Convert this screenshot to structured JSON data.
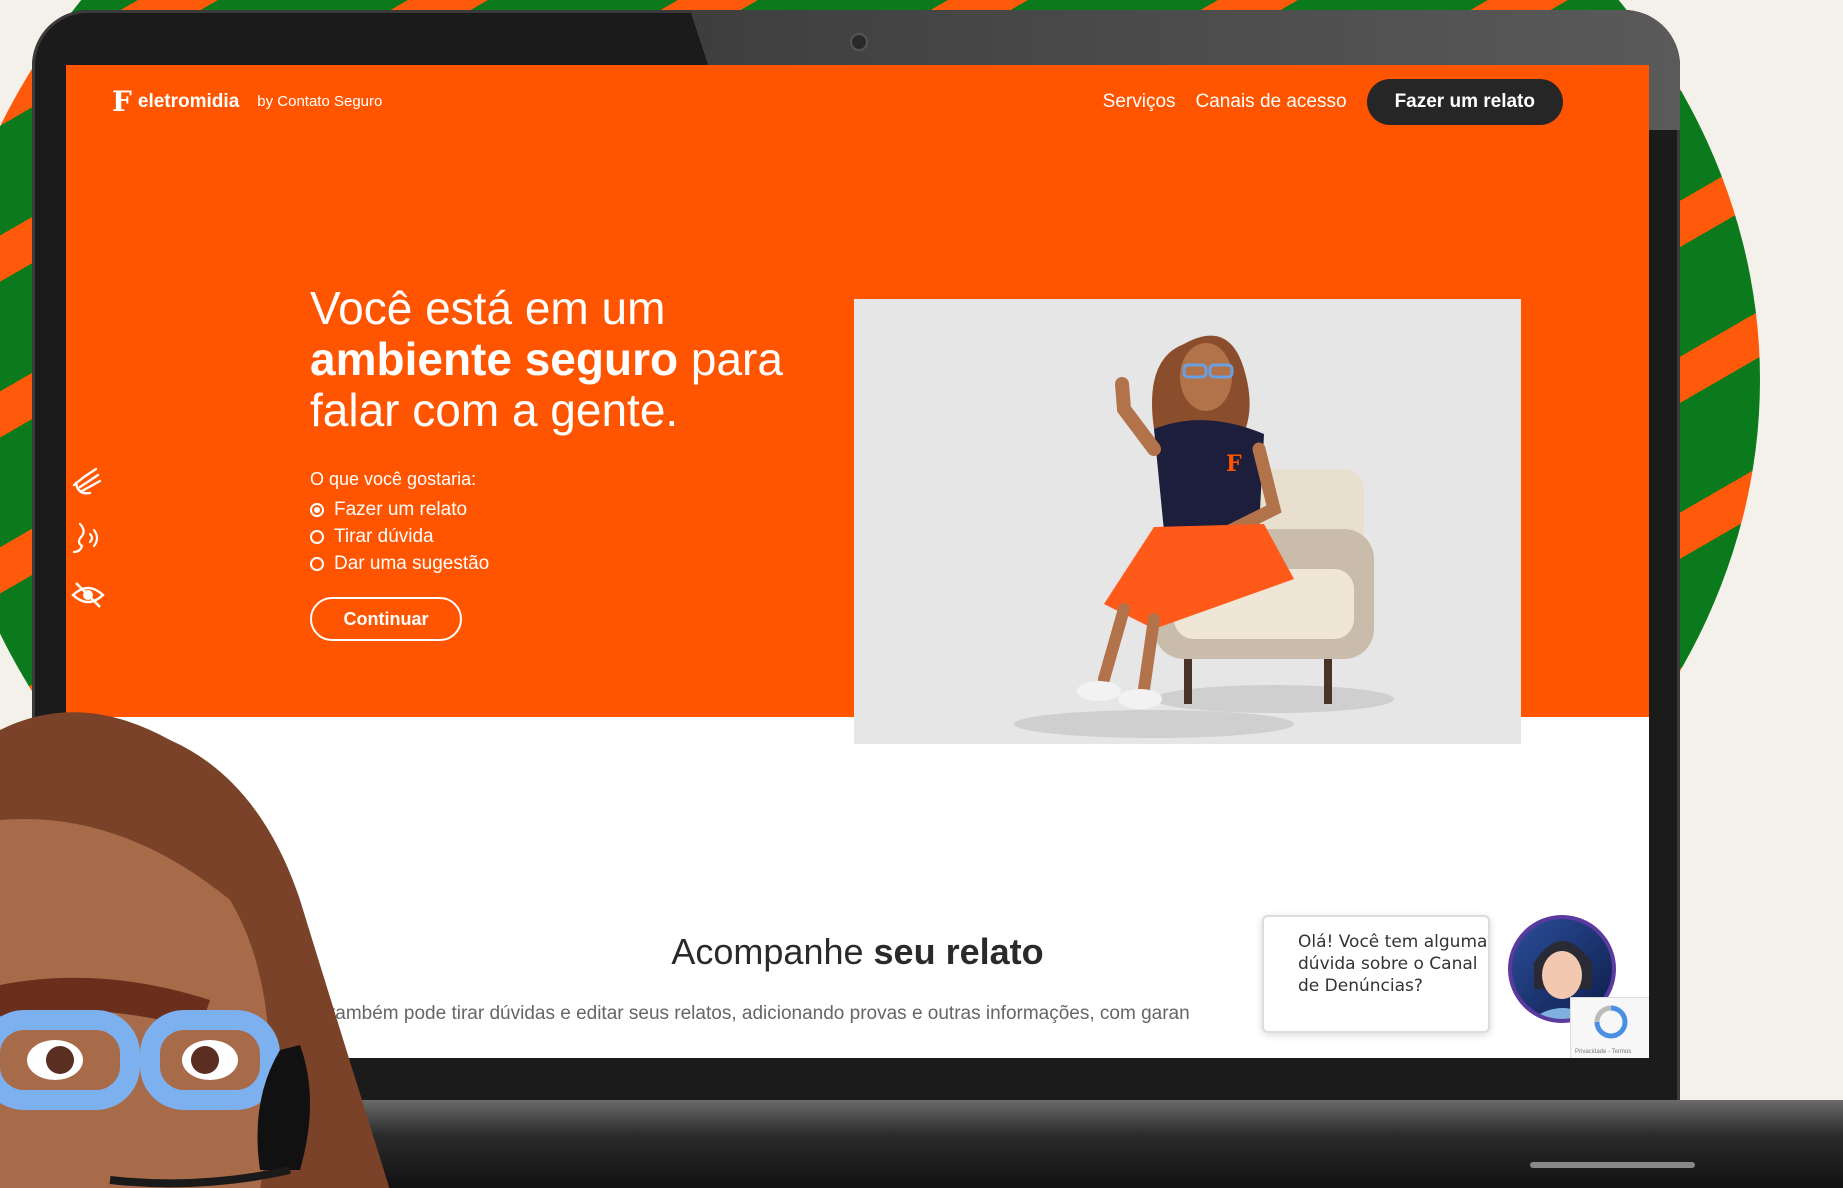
{
  "header": {
    "brand_mark": "F",
    "brand_name": "eletromidia",
    "brand_by": "by Contato Seguro",
    "nav": [
      {
        "label": "Serviços"
      },
      {
        "label": "Canais de acesso"
      }
    ],
    "cta_label": "Fazer um relato"
  },
  "hero": {
    "headline_line1": "Você está em um",
    "headline_bold": "ambiente seguro",
    "headline_rest": "para",
    "headline_line3": "falar com a gente.",
    "question": "O que você gostaria:",
    "options": [
      {
        "label": "Fazer um relato",
        "selected": true
      },
      {
        "label": "Tirar dúvida",
        "selected": false
      },
      {
        "label": "Dar uma sugestão",
        "selected": false
      }
    ],
    "continue_label": "Continuar"
  },
  "accessibility": {
    "icons": [
      "sign-language-icon",
      "audio-description-icon",
      "low-vision-icon"
    ]
  },
  "section": {
    "title_regular": "Acompanhe",
    "title_bold": "seu relato",
    "subtitle": "também pode tirar dúvidas e editar seus relatos, adicionando provas e outras informações, com garan"
  },
  "chat": {
    "bubble_text": "Olá! Você tem alguma dúvida sobre o Canal de Denúncias?"
  },
  "recaptcha": {
    "text": "Privacidade - Termos"
  },
  "colors": {
    "brand_orange": "#ff5500",
    "dark_button": "#262626",
    "ring_green": "#0b7a1c"
  }
}
